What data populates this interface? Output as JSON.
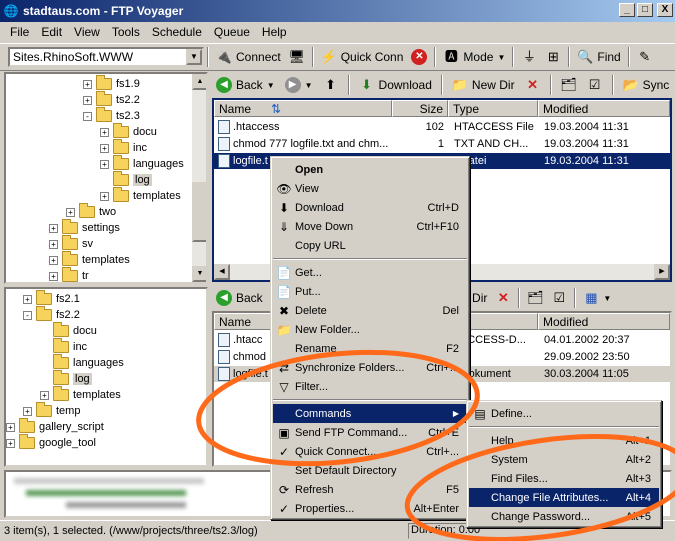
{
  "window": {
    "title": "stadtaus.com - FTP Voyager",
    "min": "_",
    "max": "□",
    "close": "X"
  },
  "menubar": [
    "File",
    "Edit",
    "View",
    "Tools",
    "Schedule",
    "Queue",
    "Help"
  ],
  "toolbar": {
    "site_combo": "Sites.RhinoSoft.WWW",
    "connect": "Connect",
    "quick_conn": "Quick Conn",
    "mode": "Mode",
    "find": "Find"
  },
  "remote_toolbar": {
    "back": "Back",
    "download": "Download",
    "new_dir": "New Dir",
    "sync": "Sync"
  },
  "local_toolbar": {
    "back": "Back",
    "new_dir": "New Dir"
  },
  "tree_top": [
    {
      "label": "fs1.9",
      "level": 3,
      "exp": "+"
    },
    {
      "label": "ts2.2",
      "level": 3,
      "exp": "+"
    },
    {
      "label": "ts2.3",
      "level": 3,
      "exp": "-"
    },
    {
      "label": "docu",
      "level": 4,
      "exp": "+"
    },
    {
      "label": "inc",
      "level": 4,
      "exp": "+"
    },
    {
      "label": "languages",
      "level": 4,
      "exp": "+"
    },
    {
      "label": "log",
      "level": 4,
      "exp": "",
      "selected": true
    },
    {
      "label": "templates",
      "level": 4,
      "exp": "+"
    },
    {
      "label": "two",
      "level": 2,
      "exp": "+"
    },
    {
      "label": "settings",
      "level": 1,
      "exp": "+"
    },
    {
      "label": "sv",
      "level": 1,
      "exp": "+"
    },
    {
      "label": "templates",
      "level": 1,
      "exp": "+"
    },
    {
      "label": "tr",
      "level": 1,
      "exp": "+"
    }
  ],
  "tree_bottom": [
    {
      "label": "fs2.1",
      "level": 1,
      "exp": "+"
    },
    {
      "label": "fs2.2",
      "level": 1,
      "exp": "-"
    },
    {
      "label": "docu",
      "level": 2,
      "exp": ""
    },
    {
      "label": "inc",
      "level": 2,
      "exp": ""
    },
    {
      "label": "languages",
      "level": 2,
      "exp": ""
    },
    {
      "label": "log",
      "level": 2,
      "exp": "",
      "selected": true
    },
    {
      "label": "templates",
      "level": 2,
      "exp": "+"
    },
    {
      "label": "temp",
      "level": 1,
      "exp": "+"
    },
    {
      "label": "gallery_script",
      "level": 0,
      "exp": "+"
    },
    {
      "label": "google_tool",
      "level": 0,
      "exp": "+"
    }
  ],
  "remote_list": {
    "headers": {
      "name": "Name",
      "size": "Size",
      "type": "Type",
      "modified": "Modified"
    },
    "rows": [
      {
        "name": ".htaccess",
        "size": "102",
        "type": "HTACCESS File",
        "modified": "19.03.2004 11:31"
      },
      {
        "name": "chmod 777 logfile.txt and chm...",
        "size": "1",
        "type": "TXT AND CH...",
        "modified": "19.03.2004 11:31"
      },
      {
        "name": "logfile.t",
        "size": "",
        "type": "xtdatei",
        "modified": "19.03.2004 11:31",
        "selected": true
      }
    ]
  },
  "local_list": {
    "headers": {
      "name": "Name",
      "type": "e",
      "modified": "Modified"
    },
    "rows": [
      {
        "name": ".htacc",
        "type": "TACCESS-D...",
        "modified": "04.01.2002 20:37"
      },
      {
        "name": "chmod",
        "type": "ei",
        "modified": "29.09.2002 23:50"
      },
      {
        "name": "logfile.t",
        "type": "xtdokument",
        "modified": "30.03.2004 11:05"
      }
    ]
  },
  "context_menu": [
    {
      "label": "Open",
      "bold": true,
      "icon": ""
    },
    {
      "label": "View",
      "icon": "👁"
    },
    {
      "label": "Download",
      "acc": "Ctrl+D",
      "icon": "⬇"
    },
    {
      "label": "Move Down",
      "acc": "Ctrl+F10",
      "icon": "⇓"
    },
    {
      "label": "Copy URL",
      "icon": ""
    },
    {
      "sep": true
    },
    {
      "label": "Get...",
      "icon": "📄"
    },
    {
      "label": "Put...",
      "icon": "📄"
    },
    {
      "label": "Delete",
      "acc": "Del",
      "icon": "✖"
    },
    {
      "label": "New Folder...",
      "icon": "📁"
    },
    {
      "label": "Rename",
      "acc": "F2",
      "icon": ""
    },
    {
      "label": "Synchronize Folders...",
      "acc": "Ctrl+...",
      "icon": "⇄"
    },
    {
      "label": "Filter...",
      "icon": "▽"
    },
    {
      "sep": true
    },
    {
      "label": "Commands",
      "submenu": true,
      "highlighted": true,
      "icon": ""
    },
    {
      "label": "Send FTP Command...",
      "acc": "Ctrl+E",
      "icon": "▣"
    },
    {
      "label": "Quick Connect...",
      "acc": "Ctrl+...",
      "icon": "✓"
    },
    {
      "label": "Set Default Directory",
      "icon": ""
    },
    {
      "label": "Refresh",
      "acc": "F5",
      "icon": "⟳"
    },
    {
      "label": "Properties...",
      "acc": "Alt+Enter",
      "icon": "✓"
    }
  ],
  "submenu": [
    {
      "label": "Define...",
      "icon": "▤"
    },
    {
      "sep": true
    },
    {
      "label": "Help",
      "acc": "Alt+1"
    },
    {
      "label": "System",
      "acc": "Alt+2"
    },
    {
      "label": "Find Files...",
      "acc": "Alt+3"
    },
    {
      "label": "Change File Attributes...",
      "acc": "Alt+4",
      "highlighted": true
    },
    {
      "label": "Change Password...",
      "acc": "Alt+5"
    }
  ],
  "status": {
    "left": "3 item(s), 1 selected.  (/www/projects/three/ts2.3/log)",
    "right": "Duration: 0:00"
  },
  "colors": {
    "highlight": "#0a246a",
    "annotation": "#ff6a1a"
  }
}
